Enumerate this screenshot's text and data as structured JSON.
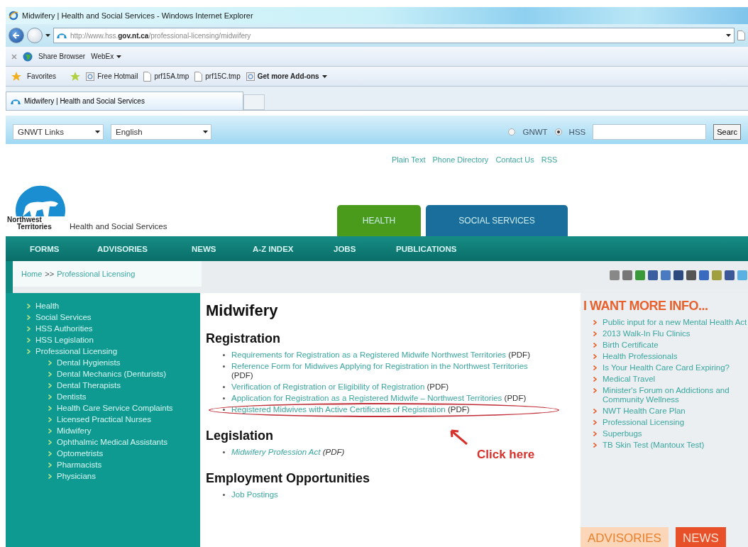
{
  "window": {
    "title": "Midwifery | Health and Social Services - Windows Internet Explorer"
  },
  "address_bar": {
    "url": "http://www.hss.**gov.nt.ca**/professional-licensing/midwifery"
  },
  "command_bar": {
    "items": [
      {
        "label": "Share Browser",
        "kind": "plain"
      },
      {
        "label": "WebEx",
        "kind": "menu"
      }
    ]
  },
  "favorites_bar": {
    "favorites": "Favorites",
    "items": [
      {
        "label": "Free Hotmail",
        "kind": "web"
      },
      {
        "label": "prf15A.tmp",
        "kind": "file"
      },
      {
        "label": "prf15C.tmp",
        "kind": "file"
      },
      {
        "label": "Get more Add-ons",
        "kind": "menu"
      }
    ]
  },
  "tabs": [
    {
      "label": "Midwifery | Health and Social Services",
      "selected": true
    }
  ],
  "site_toolbar": {
    "selects": [
      "GNWT Links",
      "English"
    ],
    "scope": [
      {
        "label": "GNWT",
        "selected": false
      },
      {
        "label": "HSS",
        "selected": true
      }
    ],
    "search_button": "Searc"
  },
  "header": {
    "links": [
      "Plain Text",
      "Phone Directory",
      "Contact Us",
      "RSS"
    ],
    "logo": {
      "line1": "Northwest",
      "line2": "Territories",
      "name": "Health and Social Services"
    },
    "tabs": [
      {
        "label": "HEALTH",
        "color": "#4a9a1c"
      },
      {
        "label": "SOCIAL SERVICES",
        "color": "#1a6e9c"
      }
    ]
  },
  "nav": [
    "FORMS",
    "ADVISORIES",
    "NEWS",
    "A-Z INDEX",
    "JOBS",
    "PUBLICATIONS"
  ],
  "breadcrumb": {
    "items": [
      "Home",
      "Professional Licensing"
    ],
    "separator": ">>"
  },
  "sidebar": {
    "items": [
      {
        "label": "Health"
      },
      {
        "label": "Social Services"
      },
      {
        "label": "HSS Authorities"
      },
      {
        "label": "HSS Legislation"
      },
      {
        "label": "Professional Licensing",
        "children": [
          {
            "label": "Dental Hygienists"
          },
          {
            "label": "Dental Mechanics (Denturists)"
          },
          {
            "label": "Dental Therapists"
          },
          {
            "label": "Dentists"
          },
          {
            "label": "Health Care Service Complaints"
          },
          {
            "label": "Licensed Practical Nurses"
          },
          {
            "label": "Midwifery"
          },
          {
            "label": "Ophthalmic Medical Assistants"
          },
          {
            "label": "Optometrists"
          },
          {
            "label": "Pharmacists"
          },
          {
            "label": "Physicians"
          }
        ]
      }
    ]
  },
  "main": {
    "title": "Midwifery",
    "sections": [
      {
        "heading": "Registration",
        "items": [
          {
            "text": "Requirements for Registration as a Registered Midwife Northwest Territories",
            "suffix": "(PDF)",
            "kind": "plain",
            "highlighted": false
          },
          {
            "text": "Reference Form for Midwives Applying for Registration in the Northwest Territories",
            "suffix": "(PDF)",
            "kind": "plain",
            "highlighted": false
          },
          {
            "text": "Verification of Registration or Eligibility of Registration",
            "suffix": "(PDF)",
            "kind": "plain",
            "highlighted": false
          },
          {
            "text": "Application for Registration as a Registered Midwife – Northwest Territories",
            "suffix": "(PDF)",
            "kind": "plain",
            "highlighted": false
          },
          {
            "text": "Registered Midwives with Active Certificates of Registration",
            "suffix": "(PDF)",
            "kind": "plain",
            "highlighted": true
          }
        ]
      },
      {
        "heading": "Legislation",
        "items": [
          {
            "text": "Midwifery Profession Act",
            "suffix": "(PDF)",
            "kind": "italic",
            "highlighted": false
          }
        ]
      },
      {
        "heading": "Employment Opportunities",
        "items": [
          {
            "text": "Job Postings",
            "kind": "plain",
            "highlighted": false
          }
        ]
      }
    ],
    "annotation": "Click here"
  },
  "info": {
    "heading": "I WANT MORE INFO...",
    "items": [
      "Public input for a new Mental Health Act",
      "2013 Walk-In Flu Clinics",
      "Birth Certificate",
      "Health Professionals",
      "Is Your Health Care Card Expiring?",
      "Medical Travel",
      "Minister's Forum on Addictions and Community Wellness",
      "NWT Health Care Plan",
      "Professional Licensing",
      "Superbugs",
      "TB Skin Test (Mantoux Test)"
    ],
    "tabs": [
      {
        "label": "ADVISORIES",
        "selected": false
      },
      {
        "label": "NEWS",
        "selected": true
      }
    ]
  }
}
